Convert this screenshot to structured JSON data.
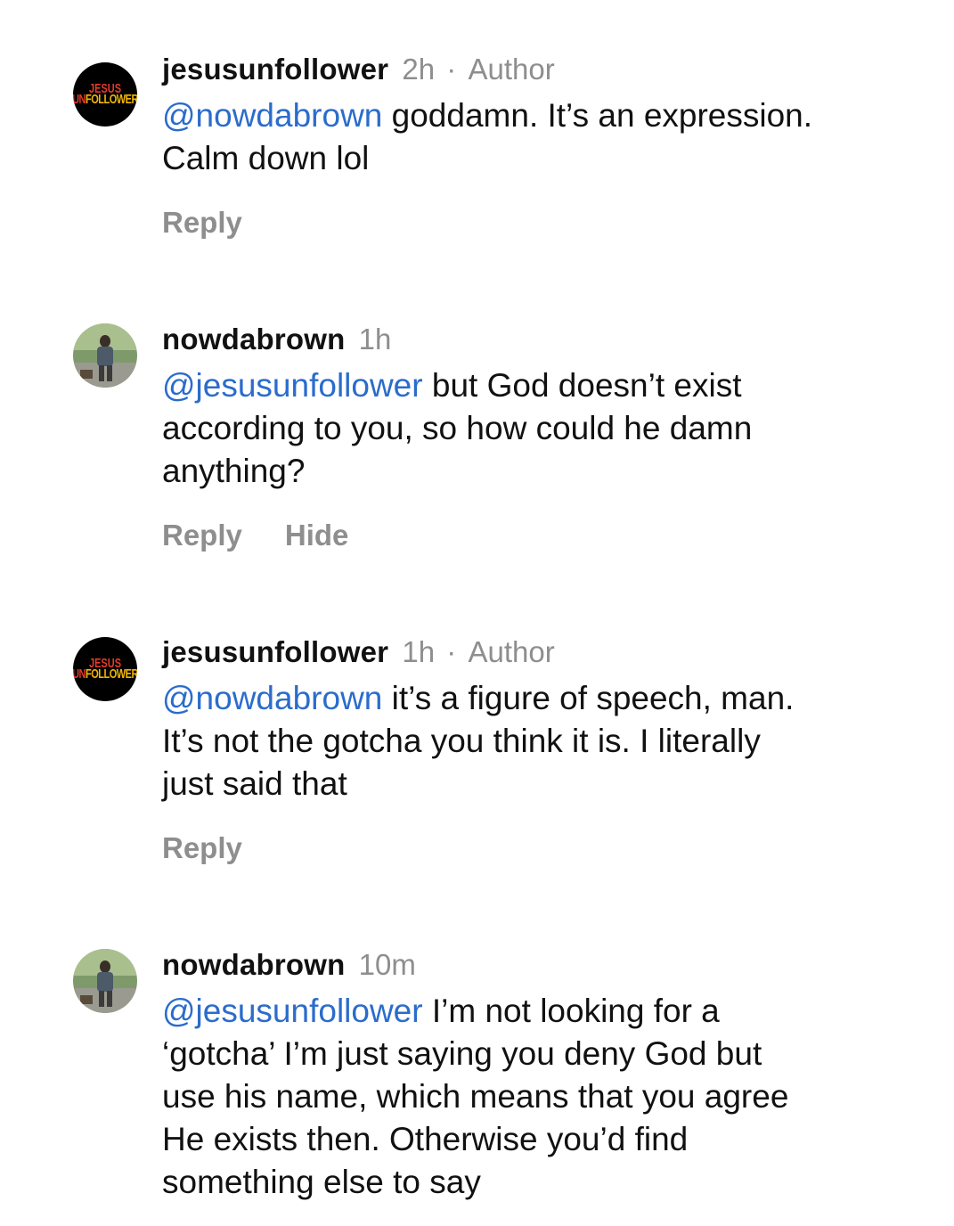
{
  "comments": [
    {
      "username": "jesusunfollower",
      "time": "2h",
      "separator": "·",
      "badge": "Author",
      "avatar": {
        "type": "logo",
        "line1": "JESUS",
        "line2_red": "UN",
        "line2_yellow": "FOLLOWER"
      },
      "mention": "@nowdabrown",
      "text_lines": [
        " goddamn. It’s an expression.",
        "Calm down lol"
      ],
      "actions": [
        "Reply"
      ]
    },
    {
      "username": "nowdabrown",
      "time": "1h",
      "separator": "",
      "badge": "",
      "avatar": {
        "type": "photo"
      },
      "mention": "@jesusunfollower",
      "text_lines": [
        " but God doesn’t exist",
        "according to you, so how could he damn",
        "anything?"
      ],
      "actions": [
        "Reply",
        "Hide"
      ]
    },
    {
      "username": "jesusunfollower",
      "time": "1h",
      "separator": "·",
      "badge": "Author",
      "avatar": {
        "type": "logo",
        "line1": "JESUS",
        "line2_red": "UN",
        "line2_yellow": "FOLLOWER"
      },
      "mention": "@nowdabrown",
      "text_lines": [
        " it’s a figure of speech, man.",
        "It’s not the gotcha you think it is. I literally",
        "just said that"
      ],
      "actions": [
        "Reply"
      ]
    },
    {
      "username": "nowdabrown",
      "time": "10m",
      "separator": "",
      "badge": "",
      "avatar": {
        "type": "photo"
      },
      "mention": "@jesusunfollower",
      "text_lines": [
        " I’m not looking for a",
        "‘gotcha’ I’m just saying you deny God but",
        "use his name, which means that you agree",
        "He exists then. Otherwise you’d find",
        "something else to say"
      ],
      "actions": []
    }
  ],
  "colors": {
    "mention": "#2b6ccc",
    "meta": "#8e8e8e",
    "text": "#111111",
    "logo_red": "#e23a2a",
    "logo_yellow": "#f2b705"
  }
}
